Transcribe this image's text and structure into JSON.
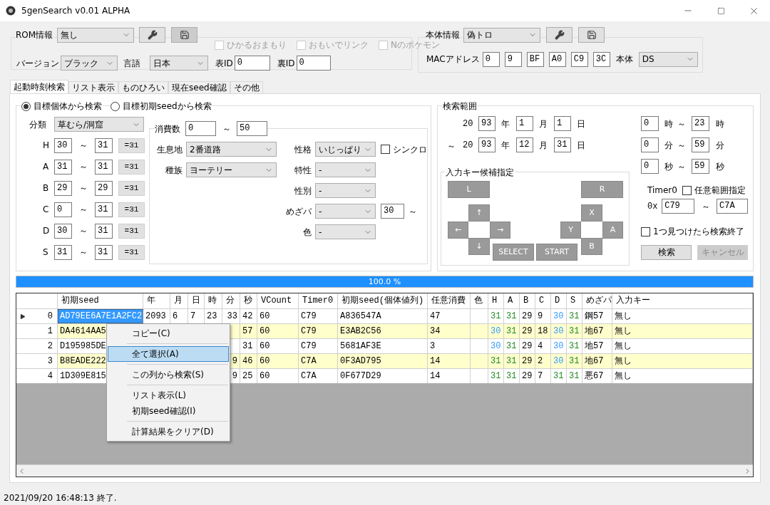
{
  "window": {
    "title": "5genSearch v0.01 ALPHA"
  },
  "rom": {
    "label": "ROM情報",
    "value": "無し",
    "checkboxes": [
      {
        "label": "ひかるおまもり",
        "checked": false,
        "disabled": true
      },
      {
        "label": "おもいでリンク",
        "checked": false,
        "disabled": true
      },
      {
        "label": "Nのポケモン",
        "checked": false,
        "disabled": true
      }
    ],
    "version_label": "バージョン",
    "version": "ブラック",
    "language_label": "言語",
    "language": "日本",
    "tid_label": "表ID",
    "tid": "0",
    "sid_label": "裏ID",
    "sid": "0"
  },
  "device": {
    "label": "本体情報",
    "value": "偽トロ",
    "mac_label": "MACアドレス",
    "mac": [
      "0",
      "9",
      "BF",
      "A0",
      "C9",
      "3C"
    ],
    "model_label": "本体",
    "model": "DS"
  },
  "tabs": [
    {
      "label": "起動時刻検索",
      "selected": true
    },
    {
      "label": "リスト表示",
      "selected": false
    },
    {
      "label": "ものひろい",
      "selected": false
    },
    {
      "label": "現在seed確認",
      "selected": false
    },
    {
      "label": "その他",
      "selected": false
    }
  ],
  "search_mode": [
    {
      "label": "目標個体から検索",
      "selected": true
    },
    {
      "label": "目標初期seedから検索",
      "selected": false
    }
  ],
  "target": {
    "category_label": "分類",
    "category": "草むら/洞窟",
    "ivs": [
      {
        "stat": "H",
        "min": "30",
        "sep": "～",
        "max": "31",
        "button": "=31"
      },
      {
        "stat": "A",
        "min": "31",
        "sep": "～",
        "max": "31",
        "button": "=31"
      },
      {
        "stat": "B",
        "min": "29",
        "sep": "～",
        "max": "29",
        "button": "=31"
      },
      {
        "stat": "C",
        "min": "0",
        "sep": "～",
        "max": "31",
        "button": "=31"
      },
      {
        "stat": "D",
        "min": "30",
        "sep": "～",
        "max": "31",
        "button": "=31"
      },
      {
        "stat": "S",
        "min": "31",
        "sep": "～",
        "max": "31",
        "button": "=31"
      }
    ],
    "consumption_label": "消費数",
    "consumption_min": "0",
    "consumption_sep": "～",
    "consumption_max": "50",
    "left_fields": [
      {
        "label": "生息地",
        "value": "2番道路"
      },
      {
        "label": "種族",
        "value": "ヨーテリー"
      }
    ],
    "right_fields": [
      {
        "label": "性格",
        "selection": "いじっぱり"
      },
      {
        "label": "特性",
        "selection": "-"
      },
      {
        "label": "性別",
        "selection": "-"
      },
      {
        "label": "めざパ",
        "selection": "-"
      },
      {
        "label": "色",
        "selection": "-"
      }
    ],
    "sync": {
      "label": "シンクロ",
      "checked": false
    },
    "hidden_power_min": "30",
    "hidden_power_sep": "～"
  },
  "range": {
    "title": "検索範囲",
    "dates": [
      {
        "century": "20",
        "parts": [
          {
            "value": "93",
            "unit": "年"
          },
          {
            "value": "1",
            "unit": "月"
          },
          {
            "value": "1",
            "unit": "日"
          }
        ]
      },
      {
        "lead": "～",
        "century": "20",
        "parts": [
          {
            "value": "93",
            "unit": "年"
          },
          {
            "value": "12",
            "unit": "月"
          },
          {
            "value": "31",
            "unit": "日"
          }
        ]
      }
    ],
    "times": [
      {
        "from": "0",
        "from_unit": "時",
        "sep": "～",
        "to": "23",
        "to_unit": "時"
      },
      {
        "from": "0",
        "from_unit": "分",
        "sep": "～",
        "to": "59",
        "to_unit": "分"
      },
      {
        "from": "0",
        "from_unit": "秒",
        "sep": "～",
        "to": "59",
        "to_unit": "秒"
      }
    ],
    "keys_title": "入力キー候補指定",
    "keys": [
      "L",
      "R",
      "↑",
      "X",
      "←",
      "→",
      "Y",
      "A",
      "↓",
      "SELECT",
      "START",
      "B"
    ],
    "timer0_label": "Timer0",
    "timer0_custom": {
      "label": "任意範囲指定",
      "checked": false
    },
    "timer0_prefix": "0x",
    "timer0_from": "C79",
    "timer0_sep": "～",
    "timer0_to": "C7A",
    "stop_on_first": {
      "label": "1つ見つけたら検索終了",
      "checked": false
    },
    "search_button": {
      "label": "検索",
      "disabled": false
    },
    "cancel_button": {
      "label": "キャンセル",
      "disabled": true
    }
  },
  "progress": {
    "level": 1.0,
    "text": "100.0 %"
  },
  "table": {
    "columns": [
      "初期seed",
      "年",
      "月",
      "日",
      "時",
      "分",
      "秒",
      "VCount",
      "Timer0",
      "初期seed(個体値列)",
      "任意消費",
      "色",
      "H",
      "A",
      "B",
      "C",
      "D",
      "S",
      "めざパ",
      "入力キー"
    ],
    "rows": [
      {
        "index": "0",
        "selected": true,
        "cells": [
          "AD79EE6A7E1A2FC2",
          "2093",
          "6",
          "7",
          "23",
          "33",
          "42",
          "60",
          "C79",
          "A836547A",
          "47",
          null
        ],
        "ivs": [
          {
            "value": "31",
            "color": "#228b22"
          },
          {
            "value": "31",
            "color": "#228b22"
          },
          {
            "value": "29",
            "color": "#000000"
          },
          {
            "value": "9",
            "color": "#000000"
          },
          {
            "value": "30",
            "color": "#3399ff"
          },
          {
            "value": "31",
            "color": "#228b22"
          }
        ],
        "hidden_power": "鋼57",
        "input_key": "無し"
      },
      {
        "index": "1",
        "selected": false,
        "cells": [
          "DA4614AA5",
          null,
          null,
          null,
          null,
          null,
          "57",
          "60",
          "C79",
          "E3AB2C56",
          "34",
          null
        ],
        "ivs": [
          {
            "value": "30",
            "color": "#3399ff"
          },
          {
            "value": "31",
            "color": "#228b22"
          },
          {
            "value": "29",
            "color": "#000000"
          },
          {
            "value": "18",
            "color": "#000000"
          },
          {
            "value": "30",
            "color": "#3399ff"
          },
          {
            "value": "31",
            "color": "#228b22"
          }
        ],
        "hidden_power": "地67",
        "input_key": "無し"
      },
      {
        "index": "2",
        "selected": false,
        "cells": [
          "D195985DE",
          null,
          null,
          null,
          null,
          null,
          "31",
          "60",
          "C79",
          "5681AF3E",
          "3",
          null
        ],
        "ivs": [
          {
            "value": "30",
            "color": "#3399ff"
          },
          {
            "value": "31",
            "color": "#228b22"
          },
          {
            "value": "29",
            "color": "#000000"
          },
          {
            "value": "4",
            "color": "#000000"
          },
          {
            "value": "30",
            "color": "#3399ff"
          },
          {
            "value": "31",
            "color": "#228b22"
          }
        ],
        "hidden_power": "地57",
        "input_key": "無し"
      },
      {
        "index": "3",
        "selected": false,
        "cells": [
          "B8EADE222",
          null,
          null,
          null,
          null,
          "9",
          "46",
          "60",
          "C7A",
          "0F3AD795",
          "14",
          null
        ],
        "ivs": [
          {
            "value": "31",
            "color": "#228b22"
          },
          {
            "value": "31",
            "color": "#228b22"
          },
          {
            "value": "29",
            "color": "#000000"
          },
          {
            "value": "2",
            "color": "#000000"
          },
          {
            "value": "30",
            "color": "#3399ff"
          },
          {
            "value": "31",
            "color": "#228b22"
          }
        ],
        "hidden_power": "地67",
        "input_key": "無し"
      },
      {
        "index": "4",
        "selected": false,
        "cells": [
          "1D309E815",
          null,
          null,
          null,
          null,
          "9",
          "25",
          "60",
          "C7A",
          "0F677D29",
          "14",
          null
        ],
        "ivs": [
          {
            "value": "31",
            "color": "#228b22"
          },
          {
            "value": "31",
            "color": "#228b22"
          },
          {
            "value": "29",
            "color": "#000000"
          },
          {
            "value": "7",
            "color": "#000000"
          },
          {
            "value": "31",
            "color": "#228b22"
          },
          {
            "value": "31",
            "color": "#228b22"
          }
        ],
        "hidden_power": "悪67",
        "input_key": "無し"
      }
    ]
  },
  "context_menu": [
    {
      "kind": "item",
      "label": "コピー(C)",
      "selected": false
    },
    {
      "kind": "separator"
    },
    {
      "kind": "item",
      "label": "全て選択(A)",
      "selected": true
    },
    {
      "kind": "separator"
    },
    {
      "kind": "item",
      "label": "この列から検索(S)",
      "selected": false
    },
    {
      "kind": "separator"
    },
    {
      "kind": "item",
      "label": "リスト表示(L)",
      "selected": false
    },
    {
      "kind": "item",
      "label": "初期seed確認(I)",
      "selected": false
    },
    {
      "kind": "separator"
    },
    {
      "kind": "item",
      "label": "計算結果をクリア(D)",
      "selected": false
    }
  ],
  "status_bar": "2021/09/20 16:48:13 終了."
}
